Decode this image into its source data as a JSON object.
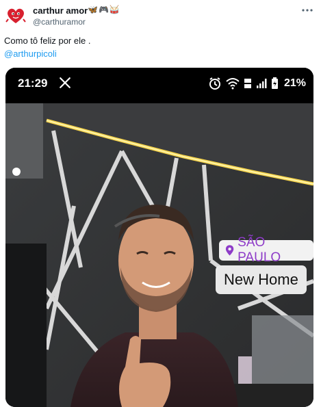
{
  "tweet": {
    "author_name": "carthur amor",
    "author_emojis": "🦋🎮🥁",
    "author_handle": "@carthuramor",
    "text": "Como tô feliz por ele .",
    "mention": "@arthurpicoli",
    "more_icon": "more-horizontal-icon"
  },
  "media": {
    "status_bar": {
      "time": "21:29",
      "battery": "21%",
      "icons": [
        "x-logo-icon",
        "alarm-icon",
        "wifi-icon",
        "volte-icon",
        "signal-icon",
        "battery-icon"
      ]
    },
    "story": {
      "location": "SÃO PAULO",
      "sticker": "New Home"
    }
  },
  "colors": {
    "link": "#1d9bf0",
    "location_sticker": "#8e3cc8",
    "text": "#0f1419",
    "secondary_text": "#536471"
  }
}
